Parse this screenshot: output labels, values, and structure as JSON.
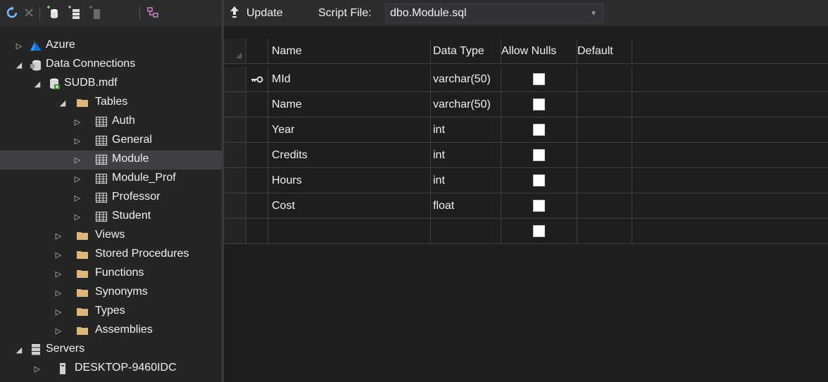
{
  "explorer": {
    "toolbar": {
      "buttons": [
        "refresh",
        "stop",
        "add-connection",
        "connect-to-server",
        "sharepoint",
        "schema-compare"
      ]
    },
    "tree": [
      {
        "label": "Azure",
        "level": 0,
        "expander": "collapsed",
        "icon": "azure-icon"
      },
      {
        "label": "Data Connections",
        "level": 0,
        "expander": "expanded",
        "icon": "data-connections-icon"
      },
      {
        "label": "SUDB.mdf",
        "level": 1,
        "expander": "expanded",
        "icon": "database-icon"
      },
      {
        "label": "Tables",
        "level": 2,
        "expander": "expanded",
        "icon": "folder-icon"
      },
      {
        "label": "Auth",
        "level": 3,
        "expander": "collapsed",
        "icon": "table-icon"
      },
      {
        "label": "General",
        "level": 3,
        "expander": "collapsed",
        "icon": "table-icon"
      },
      {
        "label": "Module",
        "level": 3,
        "expander": "collapsed",
        "icon": "table-icon",
        "selected": true
      },
      {
        "label": "Module_Prof",
        "level": 3,
        "expander": "collapsed",
        "icon": "table-icon"
      },
      {
        "label": "Professor",
        "level": 3,
        "expander": "collapsed",
        "icon": "table-icon"
      },
      {
        "label": "Student",
        "level": 3,
        "expander": "collapsed",
        "icon": "table-icon"
      },
      {
        "label": "Views",
        "level": 2,
        "expander": "collapsed",
        "icon": "folder-icon"
      },
      {
        "label": "Stored Procedures",
        "level": 2,
        "expander": "collapsed",
        "icon": "folder-icon"
      },
      {
        "label": "Functions",
        "level": 2,
        "expander": "collapsed",
        "icon": "folder-icon"
      },
      {
        "label": "Synonyms",
        "level": 2,
        "expander": "collapsed",
        "icon": "folder-icon"
      },
      {
        "label": "Types",
        "level": 2,
        "expander": "collapsed",
        "icon": "folder-icon"
      },
      {
        "label": "Assemblies",
        "level": 2,
        "expander": "collapsed",
        "icon": "folder-icon"
      },
      {
        "label": "Servers",
        "level": 0,
        "expander": "expanded",
        "icon": "servers-icon"
      },
      {
        "label": "DESKTOP-9460IDC",
        "level": 1,
        "expander": "collapsed",
        "icon": "server-icon"
      }
    ]
  },
  "designer": {
    "toolbar": {
      "update_label": "Update",
      "script_file_label": "Script File:",
      "script_file_value": "dbo.Module.sql"
    },
    "columns": [
      "Name",
      "Data Type",
      "Allow Nulls",
      "Default"
    ],
    "rows": [
      {
        "name": "MId",
        "data_type": "varchar(50)",
        "allow_nulls": false,
        "default": "",
        "primary_key": true
      },
      {
        "name": "Name",
        "data_type": "varchar(50)",
        "allow_nulls": false,
        "default": ""
      },
      {
        "name": "Year",
        "data_type": "int",
        "allow_nulls": false,
        "default": ""
      },
      {
        "name": "Credits",
        "data_type": "int",
        "allow_nulls": false,
        "default": ""
      },
      {
        "name": "Hours",
        "data_type": "int",
        "allow_nulls": false,
        "default": ""
      },
      {
        "name": "Cost",
        "data_type": "float",
        "allow_nulls": false,
        "default": ""
      },
      {
        "name": "",
        "data_type": "",
        "allow_nulls": false,
        "default": ""
      }
    ]
  },
  "colors": {
    "background": "#1e1e1e",
    "panel": "#252526",
    "toolbar": "#2d2d30",
    "selection": "#3f3f46",
    "folder": "#dcb67a",
    "azure": "#3794ff",
    "refresh": "#75beff"
  }
}
